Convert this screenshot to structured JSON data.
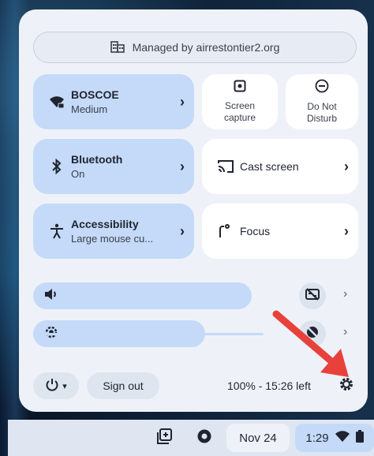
{
  "managed_banner": {
    "text": "Managed by airrestontier2.org",
    "icon": "building-icon"
  },
  "tiles": {
    "network": {
      "title": "BOSCOE",
      "subtitle": "Medium",
      "icon": "wifi-lock-icon"
    },
    "screen_capture": {
      "line1": "Screen",
      "line2": "capture",
      "icon": "screen-capture-icon"
    },
    "do_not_disturb": {
      "line1": "Do Not",
      "line2": "Disturb",
      "icon": "do-not-disturb-icon"
    },
    "bluetooth": {
      "title": "Bluetooth",
      "subtitle": "On",
      "icon": "bluetooth-icon"
    },
    "cast": {
      "title": "Cast screen",
      "icon": "cast-icon"
    },
    "accessibility": {
      "title": "Accessibility",
      "subtitle": "Large mouse cu...",
      "icon": "accessibility-icon"
    },
    "focus": {
      "title": "Focus",
      "icon": "focus-icon"
    }
  },
  "sliders": {
    "volume": {
      "icon": "volume-icon",
      "level": 0.84
    },
    "brightness": {
      "icon": "brightness-icon",
      "level": 0.66
    }
  },
  "bottom": {
    "power_icon": "power-icon",
    "sign_out": "Sign out",
    "battery": "100% - 15:26 left",
    "settings_icon": "gear-icon"
  },
  "shelf": {
    "date": "Nov 24",
    "time": "1:29"
  },
  "colors": {
    "accent": "#c4daf8",
    "panel": "#eef2f8",
    "arrow": "#e8413c"
  }
}
